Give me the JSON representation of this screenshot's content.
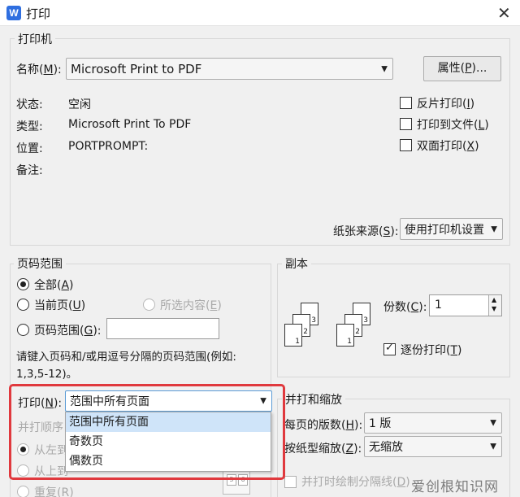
{
  "titlebar": {
    "app_icon": "W",
    "title": "打印",
    "close_glyph": "✕"
  },
  "printer": {
    "group_title": "打印机",
    "name_label": "名称",
    "name_hotkey": "M",
    "name_value": "Microsoft Print to PDF",
    "properties_label": "属性",
    "properties_hotkey": "P",
    "status_label": "状态:",
    "status_value": "空闲",
    "type_label": "类型:",
    "type_value": "Microsoft Print To PDF",
    "location_label": "位置:",
    "location_value": "PORTPROMPT:",
    "comment_label": "备注:",
    "reverse_print": {
      "label": "反片打印",
      "hotkey": "I",
      "checked": false
    },
    "print_to_file": {
      "label": "打印到文件",
      "hotkey": "L",
      "checked": false
    },
    "duplex": {
      "label": "双面打印",
      "hotkey": "X",
      "checked": false
    },
    "paper_source_label": "纸张来源",
    "paper_source_hotkey": "S",
    "paper_source_value": "使用打印机设置"
  },
  "page_range": {
    "group_title": "页码范围",
    "all": {
      "label": "全部",
      "hotkey": "A",
      "checked": true
    },
    "current": {
      "label": "当前页",
      "hotkey": "U",
      "checked": false
    },
    "selection": {
      "label": "所选内容",
      "hotkey": "E",
      "enabled": false
    },
    "pages": {
      "label": "页码范围",
      "hotkey": "G",
      "value": ""
    },
    "hint_line1": "请键入页码和/或用逗号分隔的页码范围(例如:",
    "hint_line2": "1,3,5-12)。"
  },
  "print_select": {
    "label": "打印",
    "hotkey": "N",
    "value": "范围中所有页面",
    "options": [
      "范围中所有页面",
      "奇数页",
      "偶数页"
    ],
    "selected_index": 0
  },
  "collate_order": {
    "label": "并打顺序",
    "left_right": "从左到",
    "top_bottom": "从上到",
    "repeat": "重复",
    "repeat_hotkey": "R",
    "page_numbers": [
      "5",
      "6"
    ]
  },
  "copies": {
    "group_title": "副本",
    "count_label": "份数",
    "count_hotkey": "C",
    "count_value": "1",
    "collate": {
      "label": "逐份打印",
      "hotkey": "T",
      "checked": true
    },
    "stack_numbers": [
      "1",
      "2",
      "3"
    ]
  },
  "zoom": {
    "group_title": "并打和缩放",
    "pages_per_sheet_label": "每页的版数",
    "pages_per_sheet_hotkey": "H",
    "pages_per_sheet_value": "1 版",
    "scale_label": "按纸型缩放",
    "scale_hotkey": "Z",
    "scale_value": "无缩放",
    "draw_separator": {
      "label": "并打时绘制分隔线",
      "hotkey": "D",
      "enabled": false
    }
  },
  "watermark": "爱创根知识网",
  "colors": {
    "highlight": "#e0393e",
    "selected_item": "#cfe4f9",
    "app_icon": "#2f6fe0"
  }
}
